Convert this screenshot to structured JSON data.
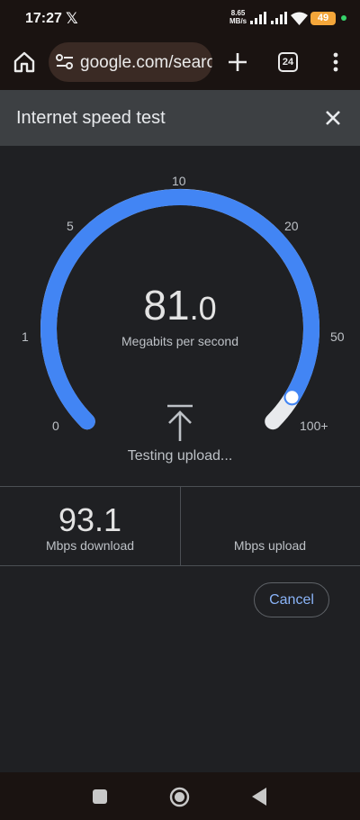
{
  "status_bar": {
    "time": "17:27",
    "notification_icon": "x-logo-icon",
    "net_speed_value": "8.65",
    "net_speed_unit": "MB/s",
    "battery": "49",
    "icons": [
      "signal-icon",
      "signal-icon",
      "wifi-icon",
      "battery-icon"
    ]
  },
  "browser": {
    "url": "google.com/search",
    "tab_count": "24",
    "icons": [
      "home-icon",
      "tune-icon",
      "plus-icon",
      "tabs-icon",
      "menu-icon"
    ]
  },
  "card": {
    "title": "Internet speed test",
    "close_icon": "close-icon"
  },
  "gauge": {
    "scale_labels": [
      "0",
      "1",
      "5",
      "10",
      "20",
      "50",
      "100+"
    ],
    "current_int": "81",
    "current_dec": ".0",
    "unit": "Megabits per second",
    "progress_fraction": 0.95,
    "status": "Testing upload...",
    "colors": {
      "arc": "#4285f4",
      "track": "#e8eaed"
    }
  },
  "results": {
    "download_value": "93.1",
    "download_label": "Mbps download",
    "upload_value": "",
    "upload_label": "Mbps upload"
  },
  "actions": {
    "cancel_label": "Cancel"
  },
  "navbar": {
    "icons": [
      "recents-icon",
      "home-icon",
      "back-icon"
    ]
  }
}
